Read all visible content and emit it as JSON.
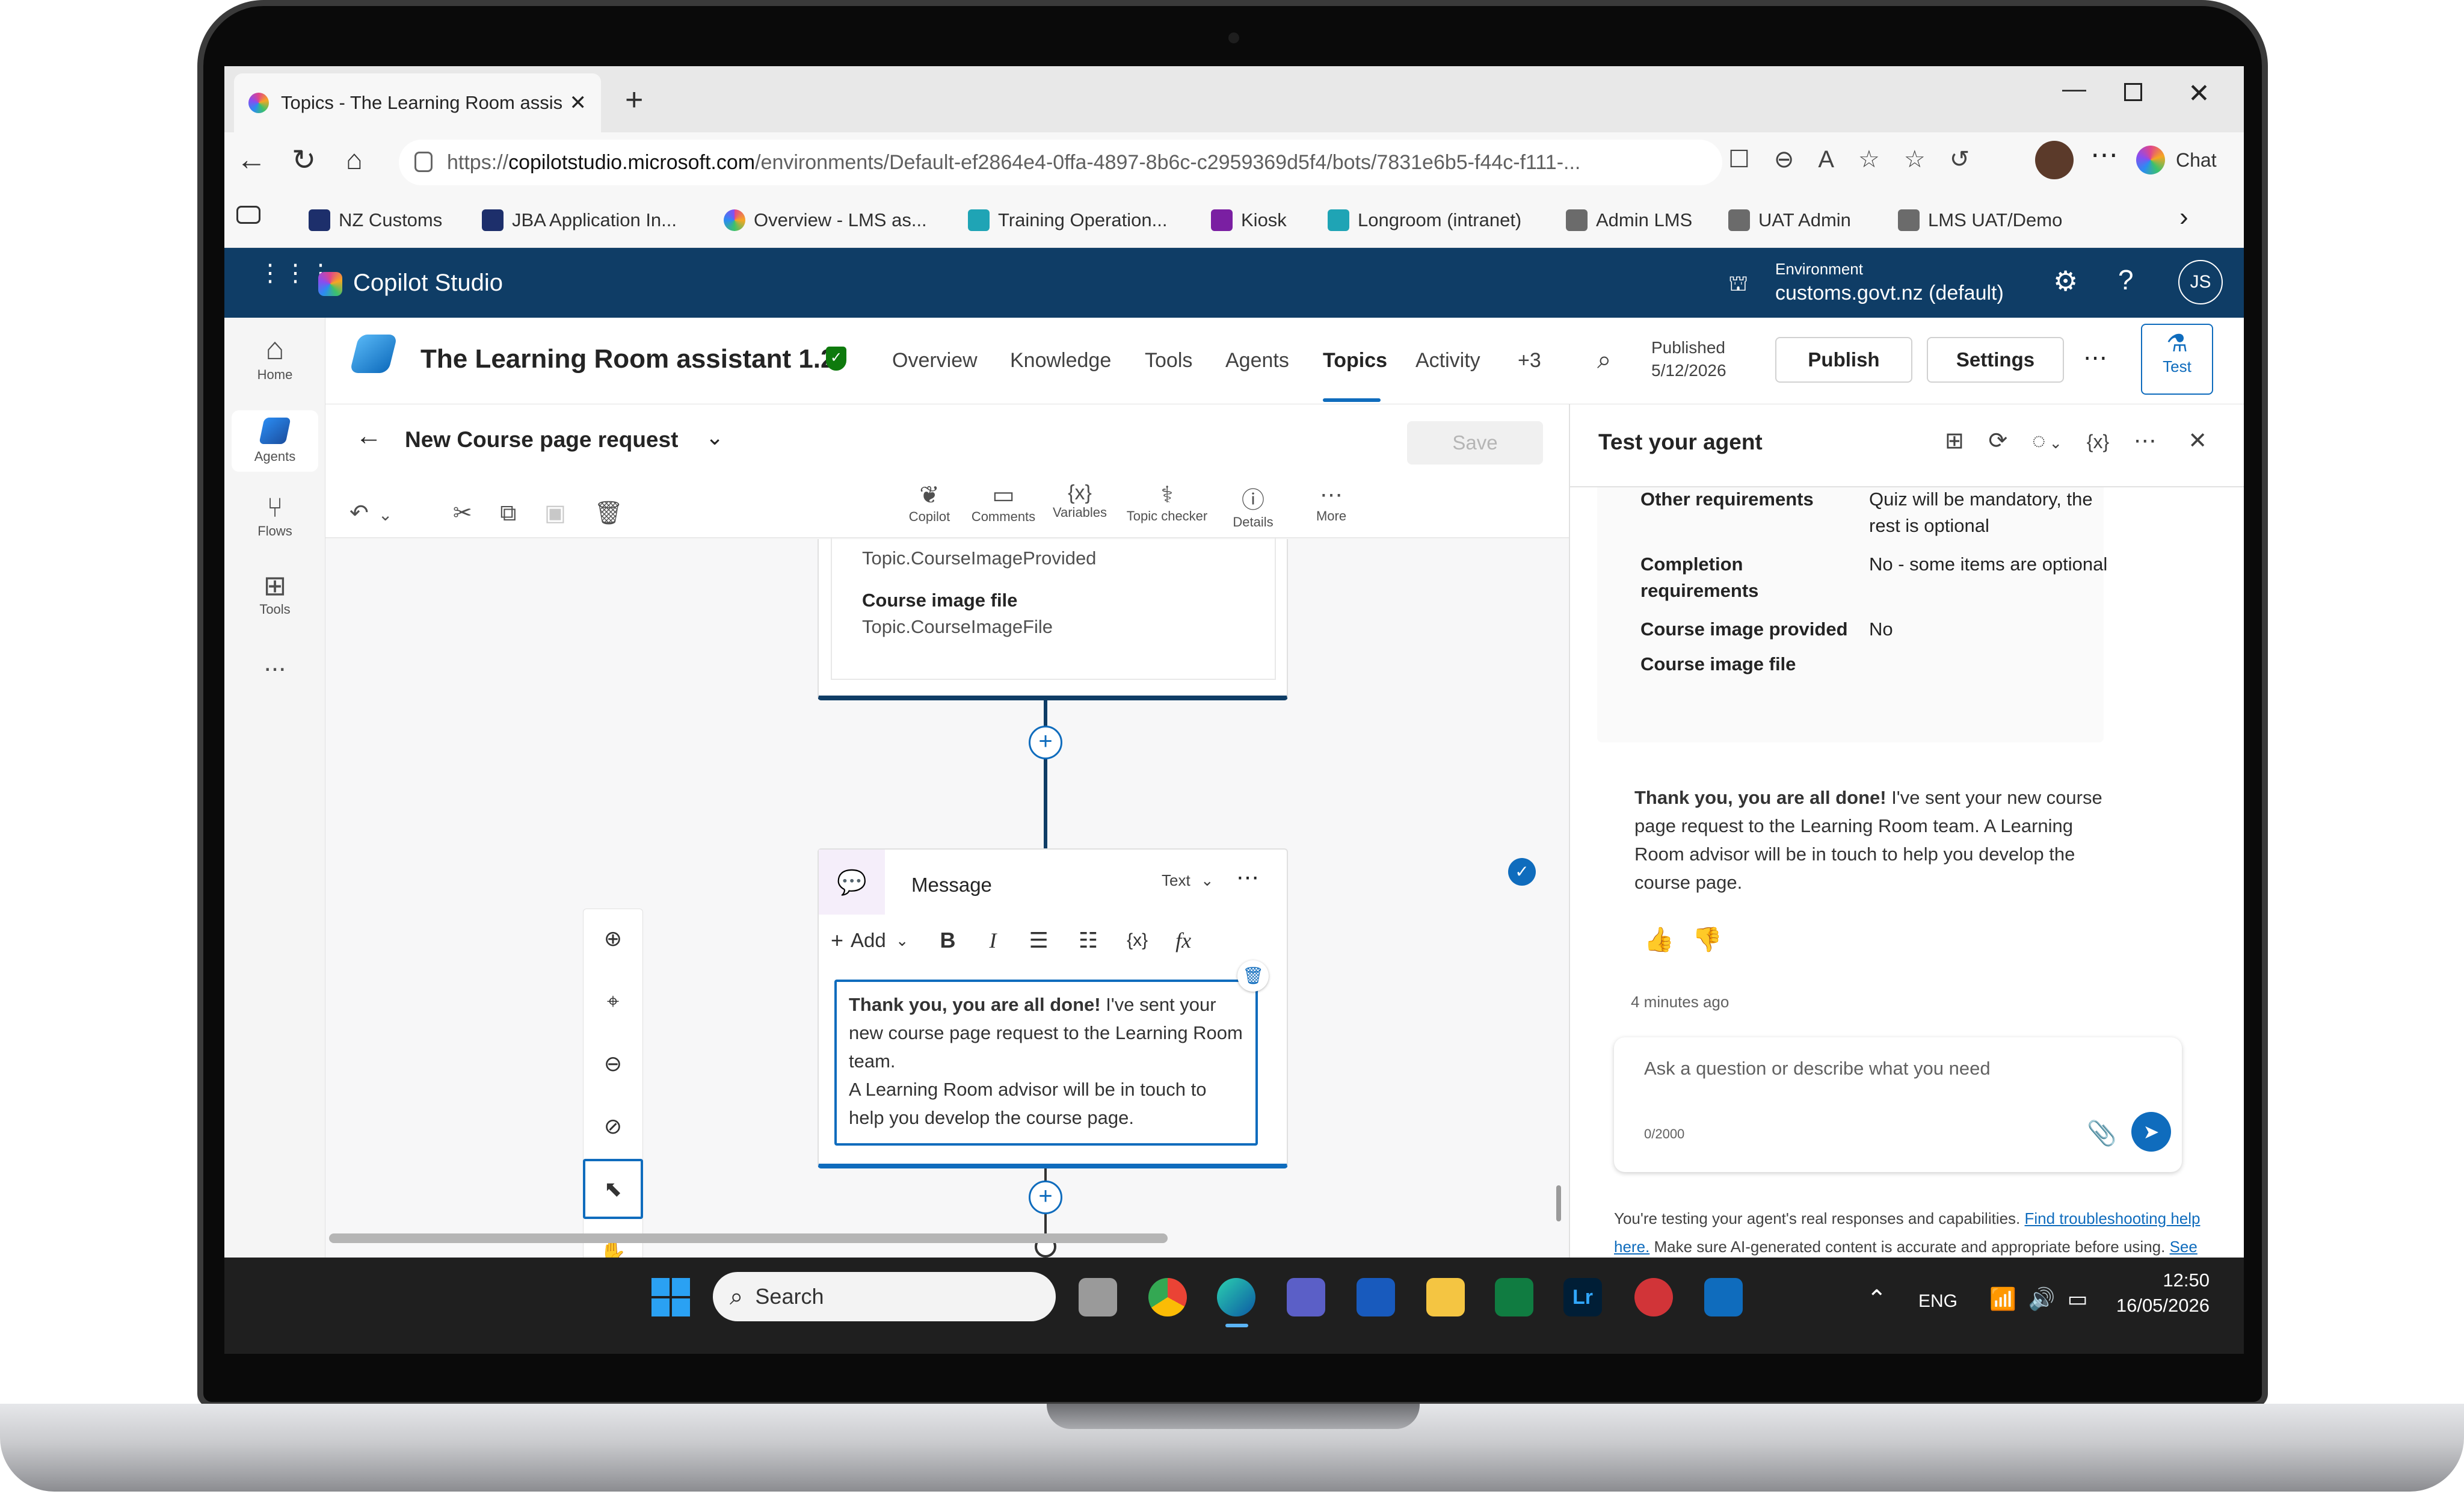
{
  "browser": {
    "tab_title": "Topics - The Learning Room assist...",
    "url_prefix": "https://",
    "url_host": "copilotstudio.microsoft.com",
    "url_path": "/environments/Default-ef2864e4-0ffa-4897-8b6c-c2959369d5f4/bots/7831e6b5-f44c-f111-...",
    "chat_label": "Chat",
    "bookmarks": [
      "NZ Customs",
      "JBA Application In...",
      "Overview - LMS as...",
      "Training Operation...",
      "Kiosk",
      "Longroom (intranet)",
      "Admin LMS",
      "UAT Admin",
      "LMS UAT/Demo"
    ]
  },
  "app": {
    "name": "Copilot Studio",
    "environment_label": "Environment",
    "environment_value": "customs.govt.nz (default)",
    "user_initials": "JS"
  },
  "rail": {
    "home": "Home",
    "agents": "Agents",
    "flows": "Flows",
    "tools": "Tools",
    "more": "..."
  },
  "agent": {
    "name": "The Learning Room assistant 1.2",
    "nav": [
      "Overview",
      "Knowledge",
      "Tools",
      "Agents",
      "Topics",
      "Activity",
      "+3"
    ],
    "active_nav": "Topics",
    "published_label": "Published",
    "published_date": "5/12/2026",
    "publish_btn": "Publish",
    "settings_btn": "Settings",
    "test_btn": "Test"
  },
  "topic": {
    "name": "New Course page request",
    "tools": [
      "Copilot",
      "Comments",
      "Variables",
      "Topic checker",
      "Details",
      "More"
    ],
    "save_btn": "Save"
  },
  "canvas": {
    "prev_card": {
      "var1": "Topic.CourseImageProvided",
      "label2": "Course image file",
      "var2": "Topic.CourseImageFile"
    },
    "message": {
      "title": "Message",
      "type": "Text",
      "add_label": "Add",
      "bold_text": "Thank you, you are all done!",
      "body_1": " I've sent your new course page request to the Learning Room team.",
      "body_2": "A Learning Room advisor will be in touch to help you develop the course page."
    }
  },
  "test": {
    "title": "Test your agent",
    "facts": [
      {
        "k": "Other requirements",
        "v": "Quiz will be mandatory, the rest is optional"
      },
      {
        "k": "Completion requirements",
        "v": "No - some items are optional"
      },
      {
        "k": "Course image provided",
        "v": "No"
      },
      {
        "k": "Course image file",
        "v": ""
      }
    ],
    "reply_bold": "Thank you, you are all done!",
    "reply_rest": " I've sent your new course page request to the Learning Room team. A Learning Room advisor will be in touch to help you develop the course page.",
    "time": "4 minutes ago",
    "input_placeholder": "Ask a question or describe what you need",
    "char_count": "0/2000",
    "footer_1": "You're testing your agent's real responses and capabilities. ",
    "footer_link1": "Find troubleshooting help here.",
    "footer_2": " Make sure AI-generated content is accurate and appropriate before using. ",
    "footer_link2": "See terms"
  },
  "taskbar": {
    "search": "Search",
    "lang": "ENG",
    "time": "12:50",
    "date": "16/05/2026"
  },
  "colors": {
    "header": "#0f3d66",
    "accent": "#0f6cbd",
    "message_border": "#0f6cbd"
  }
}
